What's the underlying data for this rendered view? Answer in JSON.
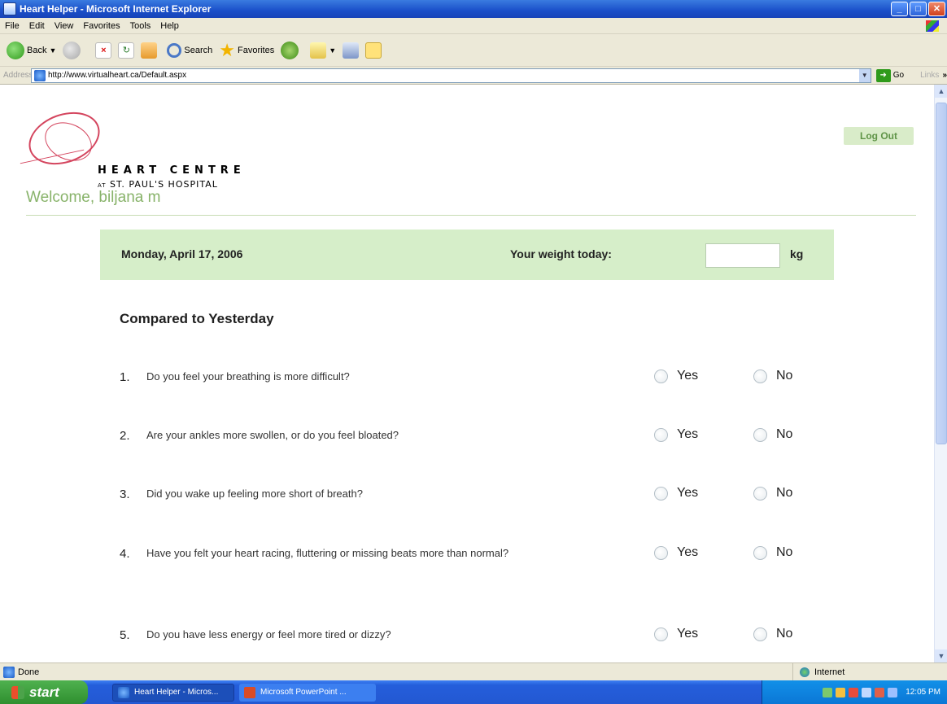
{
  "window": {
    "title": "Heart Helper - Microsoft Internet Explorer",
    "controls": {
      "minimize": "_",
      "maximize": "□",
      "close": "✕"
    }
  },
  "menu": [
    "File",
    "Edit",
    "View",
    "Favorites",
    "Tools",
    "Help"
  ],
  "toolbar": {
    "back_label": "Back",
    "search_label": "Search",
    "favorites_label": "Favorites"
  },
  "address": {
    "label": "Address",
    "url": "http://www.virtualheart.ca/Default.aspx",
    "go_label": "Go",
    "links_label": "Links",
    "more": "»"
  },
  "page": {
    "logo": {
      "name": "HEART CENTRE",
      "prefix": "AT",
      "hospital": "ST. PAUL'S HOSPITAL"
    },
    "welcome": "Welcome, biljana m",
    "logout_label": "Log Out",
    "date": "Monday, April 17, 2006",
    "weight_label": "Your weight today:",
    "weight_value": "",
    "weight_unit": "kg",
    "section_heading": "Compared to Yesterday",
    "yes_label": "Yes",
    "no_label": "No",
    "questions": [
      {
        "num": "1.",
        "text": "Do you feel your breathing is more difficult?"
      },
      {
        "num": "2.",
        "text": "Are your ankles more swollen, or do you feel bloated?"
      },
      {
        "num": "3.",
        "text": "Did you wake up feeling more short of breath?"
      },
      {
        "num": "4.",
        "text": "Have you felt your heart racing, fluttering or missing beats more than normal?"
      },
      {
        "num": "5.",
        "text": "Do you have less energy or feel more tired or dizzy?"
      }
    ]
  },
  "status": {
    "text": "Done",
    "zone": "Internet"
  },
  "taskbar": {
    "start_label": "start",
    "tasks": [
      "Heart Helper - Micros...",
      "Microsoft PowerPoint ..."
    ],
    "clock": "12:05 PM"
  },
  "colors": {
    "accent_green": "#88b36a",
    "bar_green": "#d6eec9",
    "logo_red": "#d4455e",
    "titlebar_blue": "#1a4fc9"
  }
}
